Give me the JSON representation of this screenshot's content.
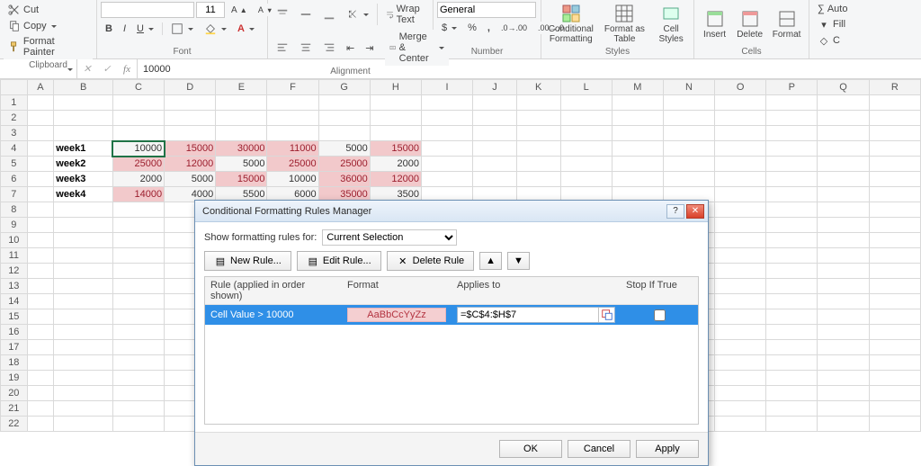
{
  "ribbon": {
    "clipboard": {
      "cut": "Cut",
      "copy": "Copy",
      "fmtpainter": "Format Painter",
      "label": "Clipboard"
    },
    "font": {
      "face": "",
      "size": "11",
      "label": "Font"
    },
    "alignment": {
      "wrap": "Wrap Text",
      "merge": "Merge & Center",
      "label": "Alignment"
    },
    "number": {
      "fmt": "General",
      "label": "Number"
    },
    "styles": {
      "cf": "Conditional Formatting",
      "fat": "Format as Table",
      "cs": "Cell Styles",
      "label": "Styles"
    },
    "cells": {
      "ins": "Insert",
      "del": "Delete",
      "fmt": "Format",
      "label": "Cells"
    },
    "editing": {
      "asum": "Auto",
      "fill": "Fill",
      "clear": "C"
    }
  },
  "formula_bar": {
    "namebox": "",
    "value": "10000",
    "fx": "fx"
  },
  "grid": {
    "cols": [
      "A",
      "B",
      "C",
      "D",
      "E",
      "F",
      "G",
      "H",
      "I",
      "J",
      "K",
      "L",
      "M",
      "N",
      "O",
      "P",
      "Q",
      "R"
    ],
    "rows": [
      "",
      "",
      "",
      "",
      "",
      "",
      "",
      "",
      "",
      "",
      "",
      "",
      "",
      "",
      "",
      "",
      "",
      "",
      "",
      "",
      "",
      ""
    ],
    "labels": [
      "week1",
      "week2",
      "week3",
      "week4"
    ],
    "data": [
      [
        10000,
        15000,
        30000,
        11000,
        5000,
        15000
      ],
      [
        25000,
        12000,
        5000,
        25000,
        25000,
        2000
      ],
      [
        2000,
        5000,
        15000,
        10000,
        36000,
        12000
      ],
      [
        14000,
        4000,
        5500,
        6000,
        35000,
        3500
      ]
    ],
    "threshold": 10000
  },
  "dialog": {
    "title": "Conditional Formatting Rules Manager",
    "show_lbl": "Show formatting rules for:",
    "show_sel": "Current Selection",
    "new": "New Rule...",
    "edit": "Edit Rule...",
    "delete": "Delete Rule",
    "col_rule": "Rule (applied in order shown)",
    "col_fmt": "Format",
    "col_app": "Applies to",
    "col_stop": "Stop If True",
    "rule_text": "Cell Value > 10000",
    "fmt_sample": "AaBbCcYyZz",
    "applies": "=$C$4:$H$7",
    "ok": "OK",
    "cancel": "Cancel",
    "apply": "Apply"
  }
}
